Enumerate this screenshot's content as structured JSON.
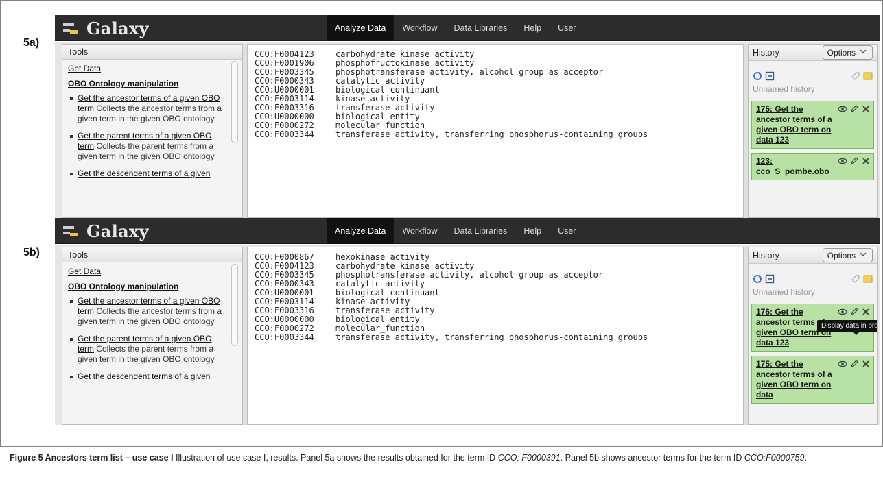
{
  "panels": [
    {
      "label": "5a)",
      "masthead": {
        "logo_text": "Galaxy",
        "tabs": [
          "Analyze Data",
          "Workflow",
          "Data Libraries",
          "Help",
          "User"
        ],
        "active_tab": "Analyze Data"
      },
      "tools": {
        "header": "Tools",
        "get_data": "Get Data",
        "section": "OBO Ontology manipulation",
        "items": [
          {
            "link": "Get the ancestor terms of a given OBO term",
            "desc": " Collects the ancestor terms from a given term in the given OBO ontology"
          },
          {
            "link": "Get the parent terms of a given OBO term",
            "desc": " Collects the parent terms from a given term in the given OBO ontology"
          },
          {
            "link": "Get the descendent terms of a given",
            "desc": ""
          }
        ]
      },
      "terms": [
        {
          "id": "CCO:F0004123",
          "name": "carbohydrate kinase activity"
        },
        {
          "id": "CCO:F0001906",
          "name": "phosphofructokinase activity"
        },
        {
          "id": "CCO:F0003345",
          "name": "phosphotransferase activity, alcohol group as acceptor"
        },
        {
          "id": "CCO:F0000343",
          "name": "catalytic activity"
        },
        {
          "id": "CCO:U0000001",
          "name": "biological continuant"
        },
        {
          "id": "CCO:F0003114",
          "name": "kinase activity"
        },
        {
          "id": "CCO:F0003316",
          "name": "transferase activity"
        },
        {
          "id": "CCO:U0000000",
          "name": "biological entity"
        },
        {
          "id": "CCO:F0000272",
          "name": "molecular_function"
        },
        {
          "id": "CCO:F0003344",
          "name": "transferase activity, transferring phosphorus-containing groups"
        }
      ],
      "history": {
        "header": "History",
        "options": "Options",
        "name": "Unnamed history",
        "datasets": [
          {
            "title": "175: Get the ancestor terms of a given OBO term on data 123"
          },
          {
            "title": "123: cco_S_pombe.obo"
          }
        ]
      }
    },
    {
      "label": "5b)",
      "masthead": {
        "logo_text": "Galaxy",
        "tabs": [
          "Analyze Data",
          "Workflow",
          "Data Libraries",
          "Help",
          "User"
        ],
        "active_tab": "Analyze Data"
      },
      "tools": {
        "header": "Tools",
        "get_data": "Get Data",
        "section": "OBO Ontology manipulation",
        "items": [
          {
            "link": "Get the ancestor terms of a given OBO term",
            "desc": " Collects the ancestor terms from a given term in the given OBO ontology"
          },
          {
            "link": "Get the parent terms of a given OBO term",
            "desc": " Collects the parent terms from a given term in the given OBO ontology"
          },
          {
            "link": "Get the descendent terms of a given",
            "desc": ""
          }
        ]
      },
      "terms": [
        {
          "id": "CCO:F0000867",
          "name": "hexokinase activity"
        },
        {
          "id": "CCO:F0004123",
          "name": "carbohydrate kinase activity"
        },
        {
          "id": "CCO:F0003345",
          "name": "phosphotransferase activity, alcohol group as acceptor"
        },
        {
          "id": "CCO:F0000343",
          "name": "catalytic activity"
        },
        {
          "id": "CCO:U0000001",
          "name": "biological continuant"
        },
        {
          "id": "CCO:F0003114",
          "name": "kinase activity"
        },
        {
          "id": "CCO:F0003316",
          "name": "transferase activity"
        },
        {
          "id": "CCO:U0000000",
          "name": "biological entity"
        },
        {
          "id": "CCO:F0000272",
          "name": "molecular_function"
        },
        {
          "id": "CCO:F0003344",
          "name": "transferase activity, transferring phosphorus-containing groups"
        }
      ],
      "history": {
        "header": "History",
        "options": "Options",
        "name": "Unnamed history",
        "tooltip": "Display data in browser",
        "datasets": [
          {
            "title": "176: Get the ancestor terms of a given OBO term on data 123"
          },
          {
            "title": "175: Get the ancestor terms of a given OBO term on data"
          }
        ]
      }
    }
  ],
  "caption": {
    "fig": "Figure 5 Ancestors term list – use case I",
    "text1": " Illustration of use case I, results. Panel 5a shows the results obtained for the term ID ",
    "term1": "CCO: F0000391",
    "text2": ". Panel 5b shows ancestor terms for the term ID ",
    "term2": "CCO:F0000759",
    "text3": "."
  },
  "colors": {
    "masthead": "#2c2c2c",
    "active_tab": "#111111",
    "dataset_ok": "#b7e2a3",
    "logo_accent": "#f2c23a"
  },
  "icons": [
    "eye-icon",
    "pencil-icon",
    "delete-icon",
    "refresh-icon",
    "collapse-icon",
    "tag-icon",
    "annotate-icon",
    "chevron-down-icon"
  ]
}
